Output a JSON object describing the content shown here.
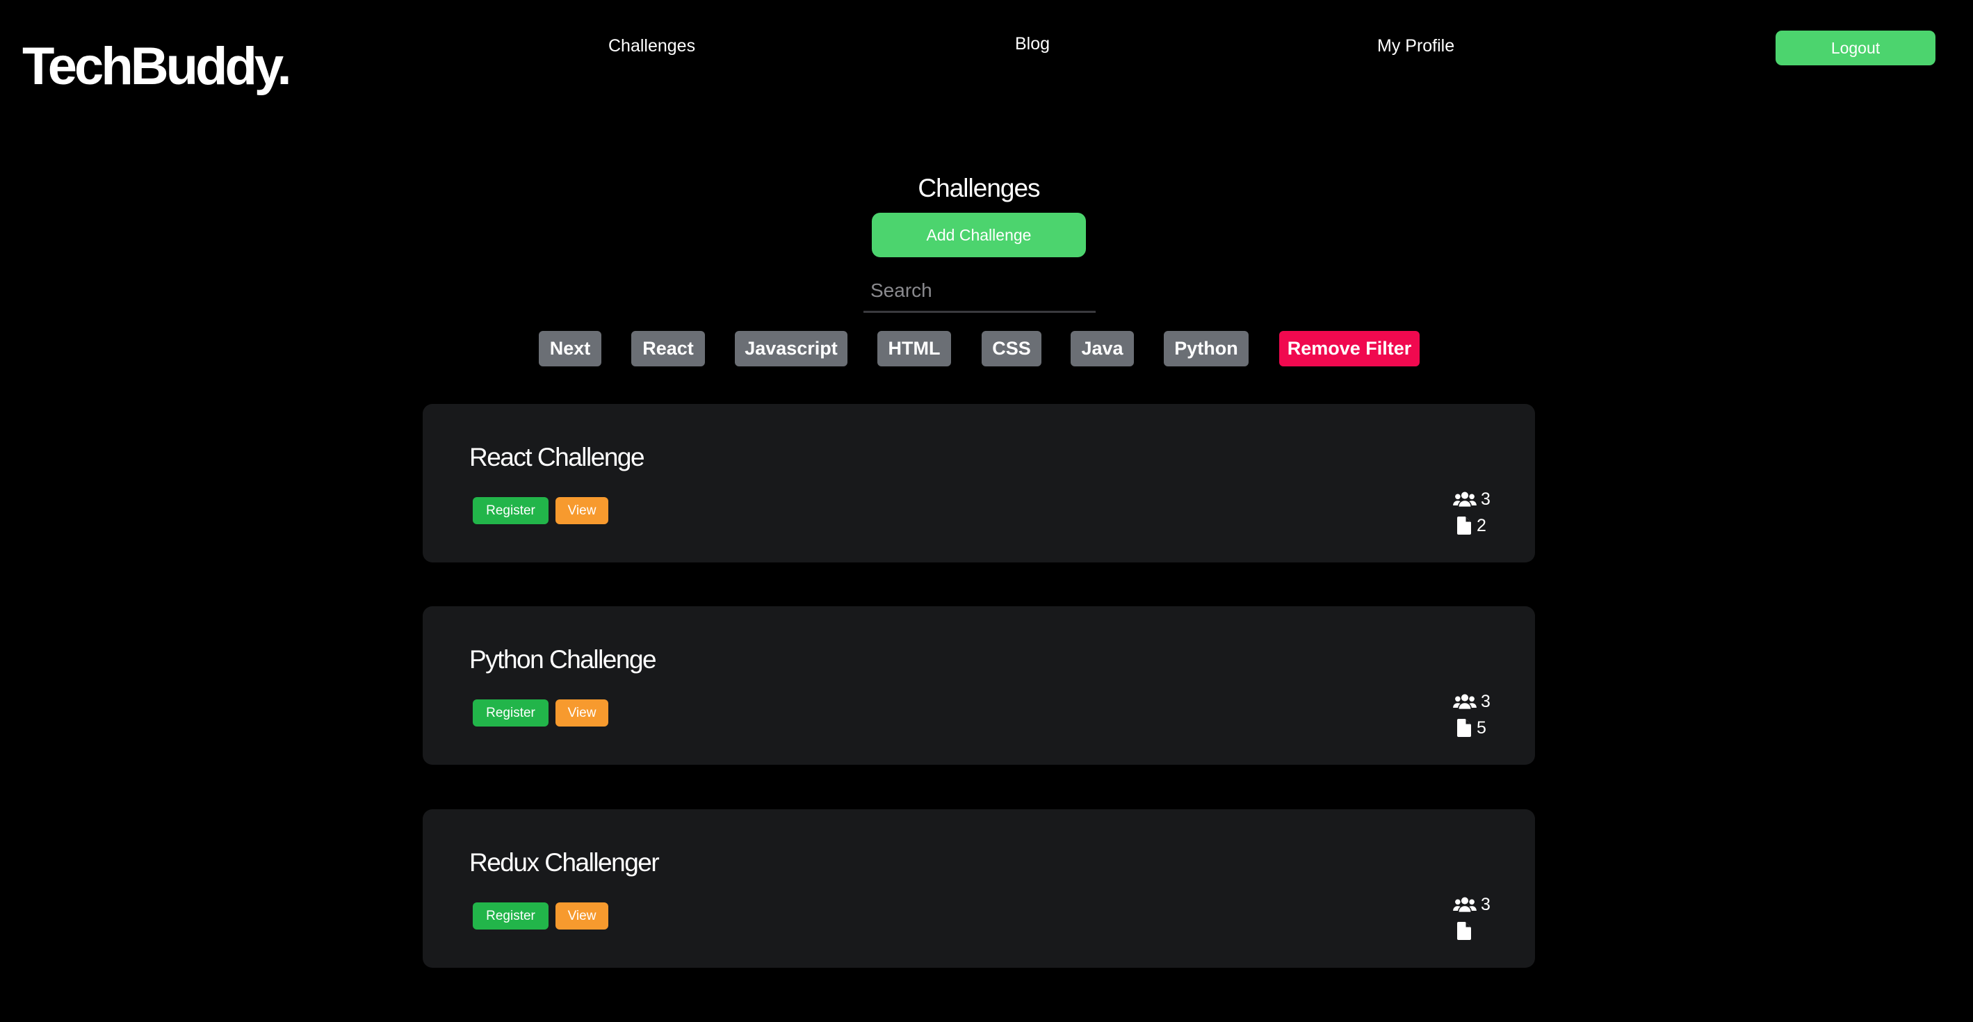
{
  "brand": {
    "logo": "TechBuddy."
  },
  "nav": {
    "challenges": "Challenges",
    "blog": "Blog",
    "profile": "My Profile",
    "logout": "Logout"
  },
  "main": {
    "title": "Challenges",
    "add_button": "Add Challenge",
    "search_placeholder": "Search"
  },
  "filters": [
    "Next",
    "React",
    "Javascript",
    "HTML",
    "CSS",
    "Java",
    "Python"
  ],
  "remove_filter": "Remove Filter",
  "challenges": [
    {
      "title": "React Challenge",
      "register": "Register",
      "view": "View",
      "members": "3",
      "files": "2"
    },
    {
      "title": "Python Challenge",
      "register": "Register",
      "view": "View",
      "members": "3",
      "files": "5"
    },
    {
      "title": "Redux Challenger",
      "register": "Register",
      "view": "View",
      "members": "3",
      "files": ""
    }
  ],
  "colors": {
    "accent_green": "#4cd46e",
    "register_green": "#22b54a",
    "view_orange": "#f79a2e",
    "remove_red": "#f0094f",
    "chip_gray": "#6b6f75",
    "card_bg": "#18191b",
    "background": "#000000"
  },
  "icons": {
    "members": "users-icon",
    "files": "file-icon"
  }
}
